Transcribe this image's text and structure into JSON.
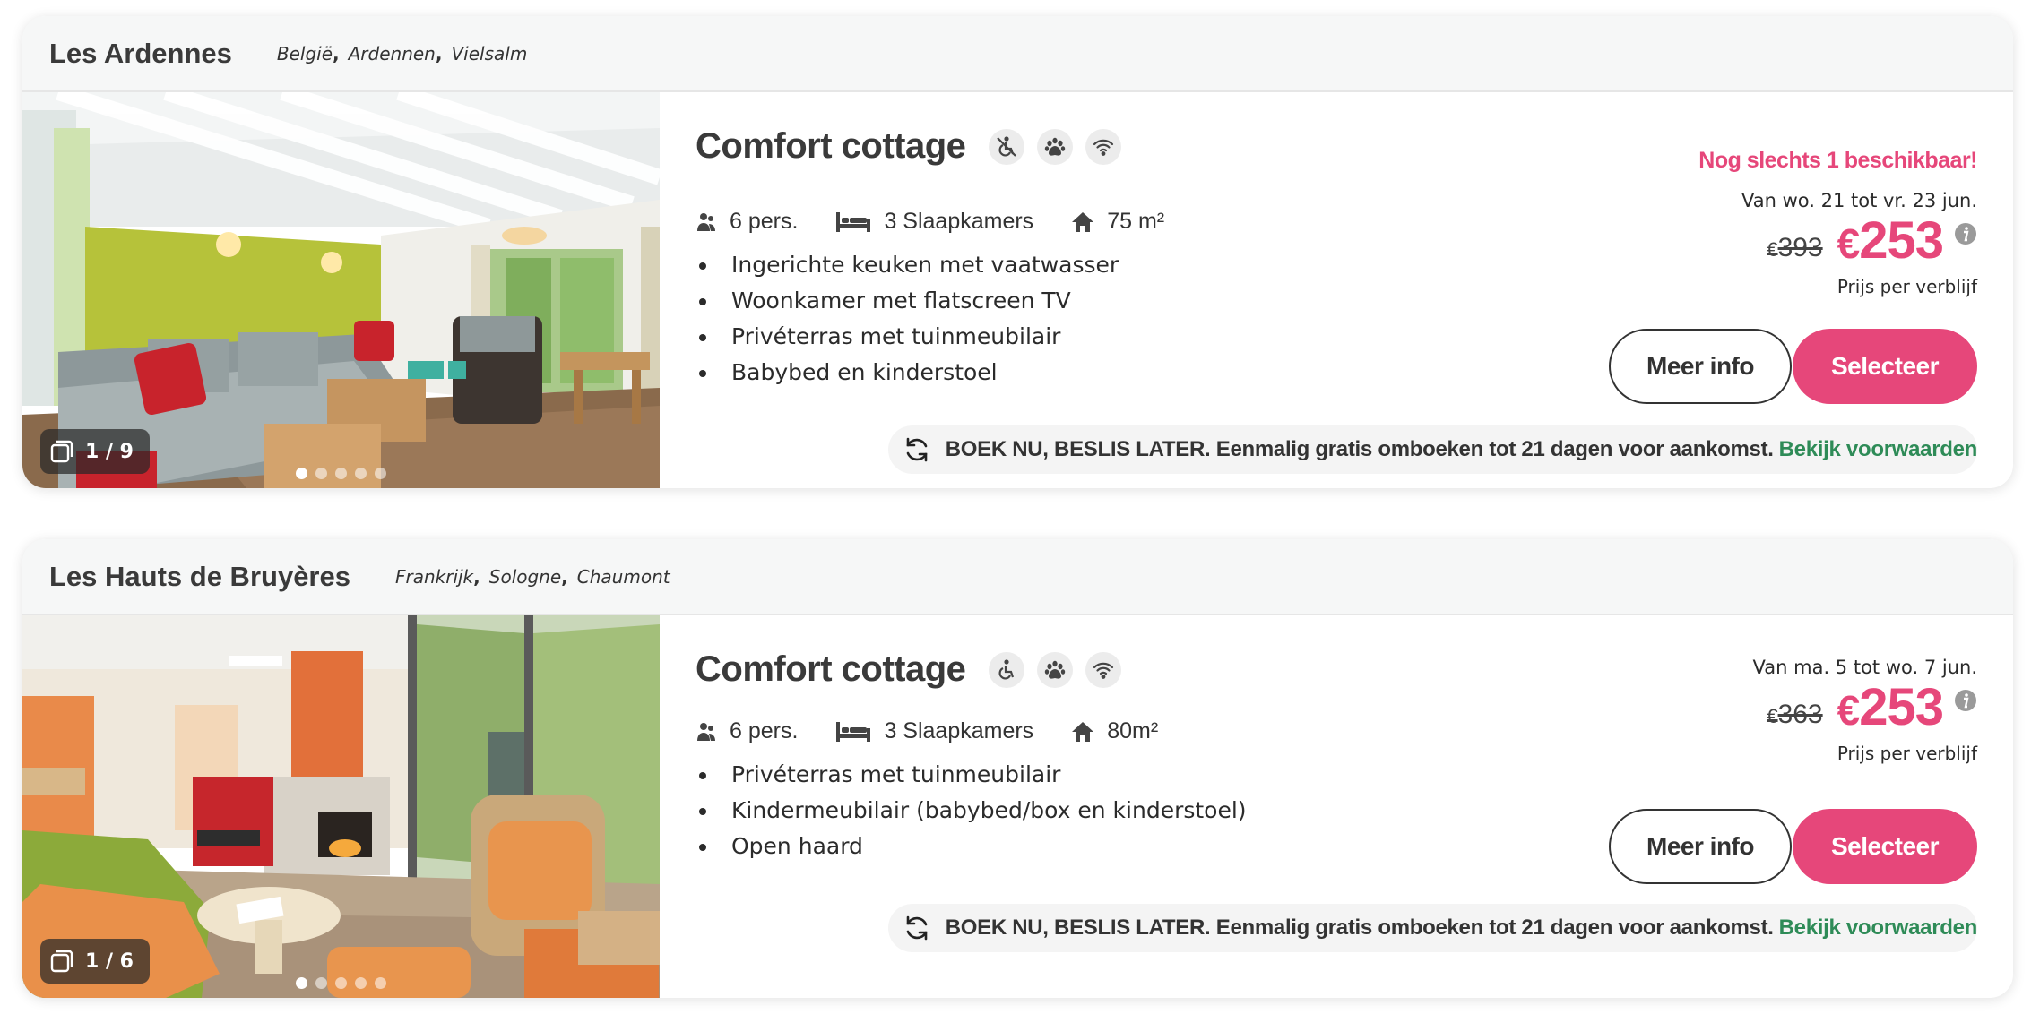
{
  "listings": [
    {
      "park_name": "Les Ardennes",
      "location": [
        "België",
        "Ardennen",
        "Vielsalm"
      ],
      "photo": {
        "counter": "1 / 9",
        "dot_count": 5,
        "active_dot": 0,
        "scene": "living room with green wall and grey corner sofa"
      },
      "title": "Comfort cottage",
      "amenity_icons": [
        "no-wheelchair-icon",
        "pet-paw-icon",
        "wifi-icon"
      ],
      "specs": {
        "persons": "6 pers.",
        "bedrooms": "3 Slaapkamers",
        "area": "75 m²"
      },
      "features": [
        "Ingerichte keuken met vaatwasser",
        "Woonkamer met flatscreen TV",
        "Privéterras met tuinmeubilair",
        "Babybed en kinderstoel"
      ],
      "availability": "Nog slechts 1 beschikbaar!",
      "dates": "Van wo. 21 tot vr. 23 jun.",
      "old_price": {
        "currency": "€",
        "amount": "393"
      },
      "new_price": {
        "currency": "€",
        "amount": "253"
      },
      "price_note": "Prijs per verblijf",
      "more_info_label": "Meer info",
      "select_label": "Selecteer",
      "booking_notice": "BOEK NU, BESLIS LATER. Eenmalig gratis omboeken tot 21 dagen voor aankomst.",
      "booking_link": "Bekijk voorwaarden"
    },
    {
      "park_name": "Les Hauts de Bruyères",
      "location": [
        "Frankrijk",
        "Sologne",
        "Chaumont"
      ],
      "photo": {
        "counter": "1 / 6",
        "dot_count": 5,
        "active_dot": 0,
        "scene": "living room with orange fireplace and wicker chairs"
      },
      "title": "Comfort cottage",
      "amenity_icons": [
        "wheelchair-icon",
        "pet-paw-icon",
        "wifi-icon"
      ],
      "specs": {
        "persons": "6 pers.",
        "bedrooms": "3 Slaapkamers",
        "area": "80m²"
      },
      "features": [
        "Privéterras met tuinmeubilair",
        "Kindermeubilair (babybed/box en kinderstoel)",
        "Open haard"
      ],
      "dates": "Van ma. 5 tot wo. 7 jun.",
      "old_price": {
        "currency": "€",
        "amount": "363"
      },
      "new_price": {
        "currency": "€",
        "amount": "253"
      },
      "price_note": "Prijs per verblijf",
      "more_info_label": "Meer info",
      "select_label": "Selecteer",
      "booking_notice": "BOEK NU, BESLIS LATER. Eenmalig gratis omboeken tot 21 dagen voor aankomst.",
      "booking_link": "Bekijk voorwaarden"
    }
  ],
  "colors": {
    "accent": "#e6477a",
    "link": "#2e8b57",
    "header_bg": "#f6f7f7",
    "text": "#2b2b2b"
  }
}
